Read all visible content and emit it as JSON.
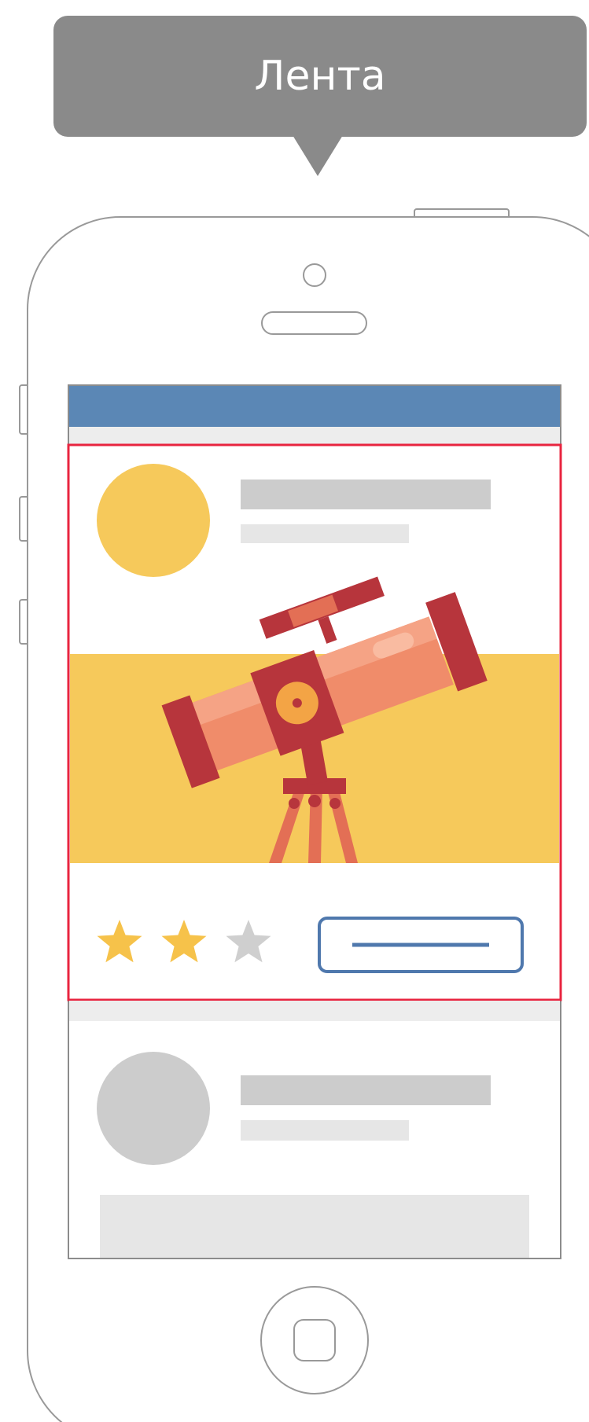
{
  "tooltip": {
    "label": "Лента"
  },
  "screen": {
    "header_color": "#5b87b5"
  },
  "featured_post": {
    "highlight_color": "#e8243f",
    "avatar_color": "#f6c95b",
    "banner_color": "#f6c95b",
    "image_icon": "telescope-icon",
    "rating": {
      "value": 2,
      "max": 3,
      "filled_color": "#f6c24a",
      "empty_color": "#cfcfcf"
    },
    "action_button_color": "#4f78ad"
  },
  "second_post": {
    "avatar_color": "#cccccc"
  }
}
